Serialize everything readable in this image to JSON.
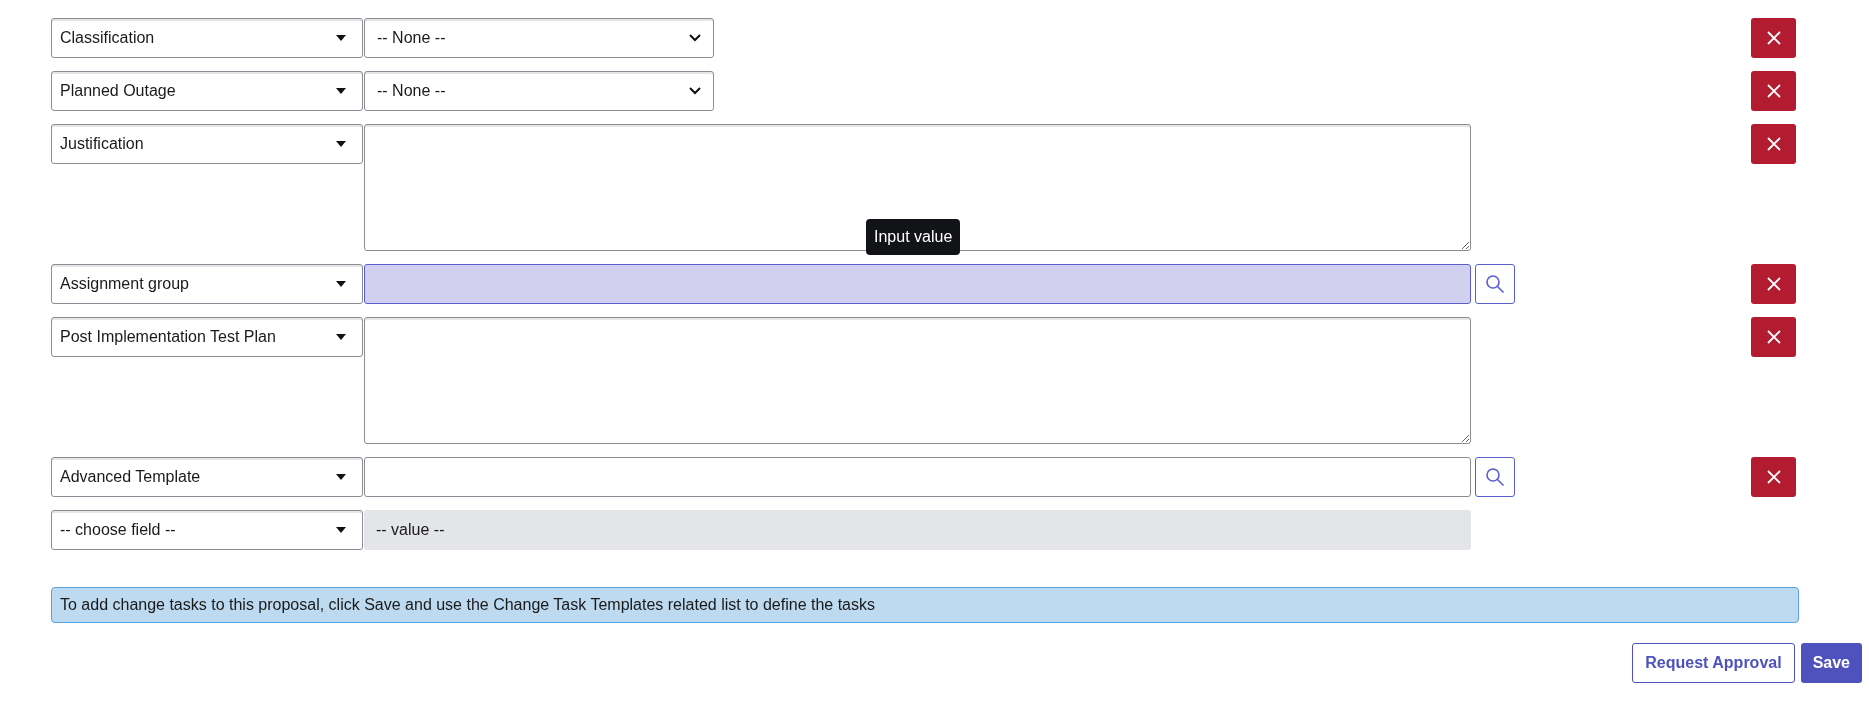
{
  "rows": [
    {
      "kind": "select",
      "field": "Classification",
      "value": "-- None --",
      "removable": true
    },
    {
      "kind": "select",
      "field": "Planned Outage",
      "value": "-- None --",
      "removable": true
    },
    {
      "kind": "textarea",
      "field": "Justification",
      "value": "",
      "removable": true
    },
    {
      "kind": "reference",
      "field": "Assignment group",
      "focused": true,
      "tooltip": "Input value",
      "removable": true
    },
    {
      "kind": "textarea",
      "field": "Post Implementation Test Plan",
      "removable": true
    },
    {
      "kind": "reference",
      "field": "Advanced Template",
      "focused": false,
      "removable": true
    },
    {
      "kind": "empty",
      "field": "-- choose field --",
      "value": "-- value --",
      "removable": false
    }
  ],
  "info": "To add change tasks to this proposal, click Save and use the Change Task Templates related list to define the tasks",
  "buttons": [
    {
      "label": "Request Approval",
      "kind": "secondary"
    },
    {
      "label": "Save",
      "kind": "primary"
    }
  ]
}
